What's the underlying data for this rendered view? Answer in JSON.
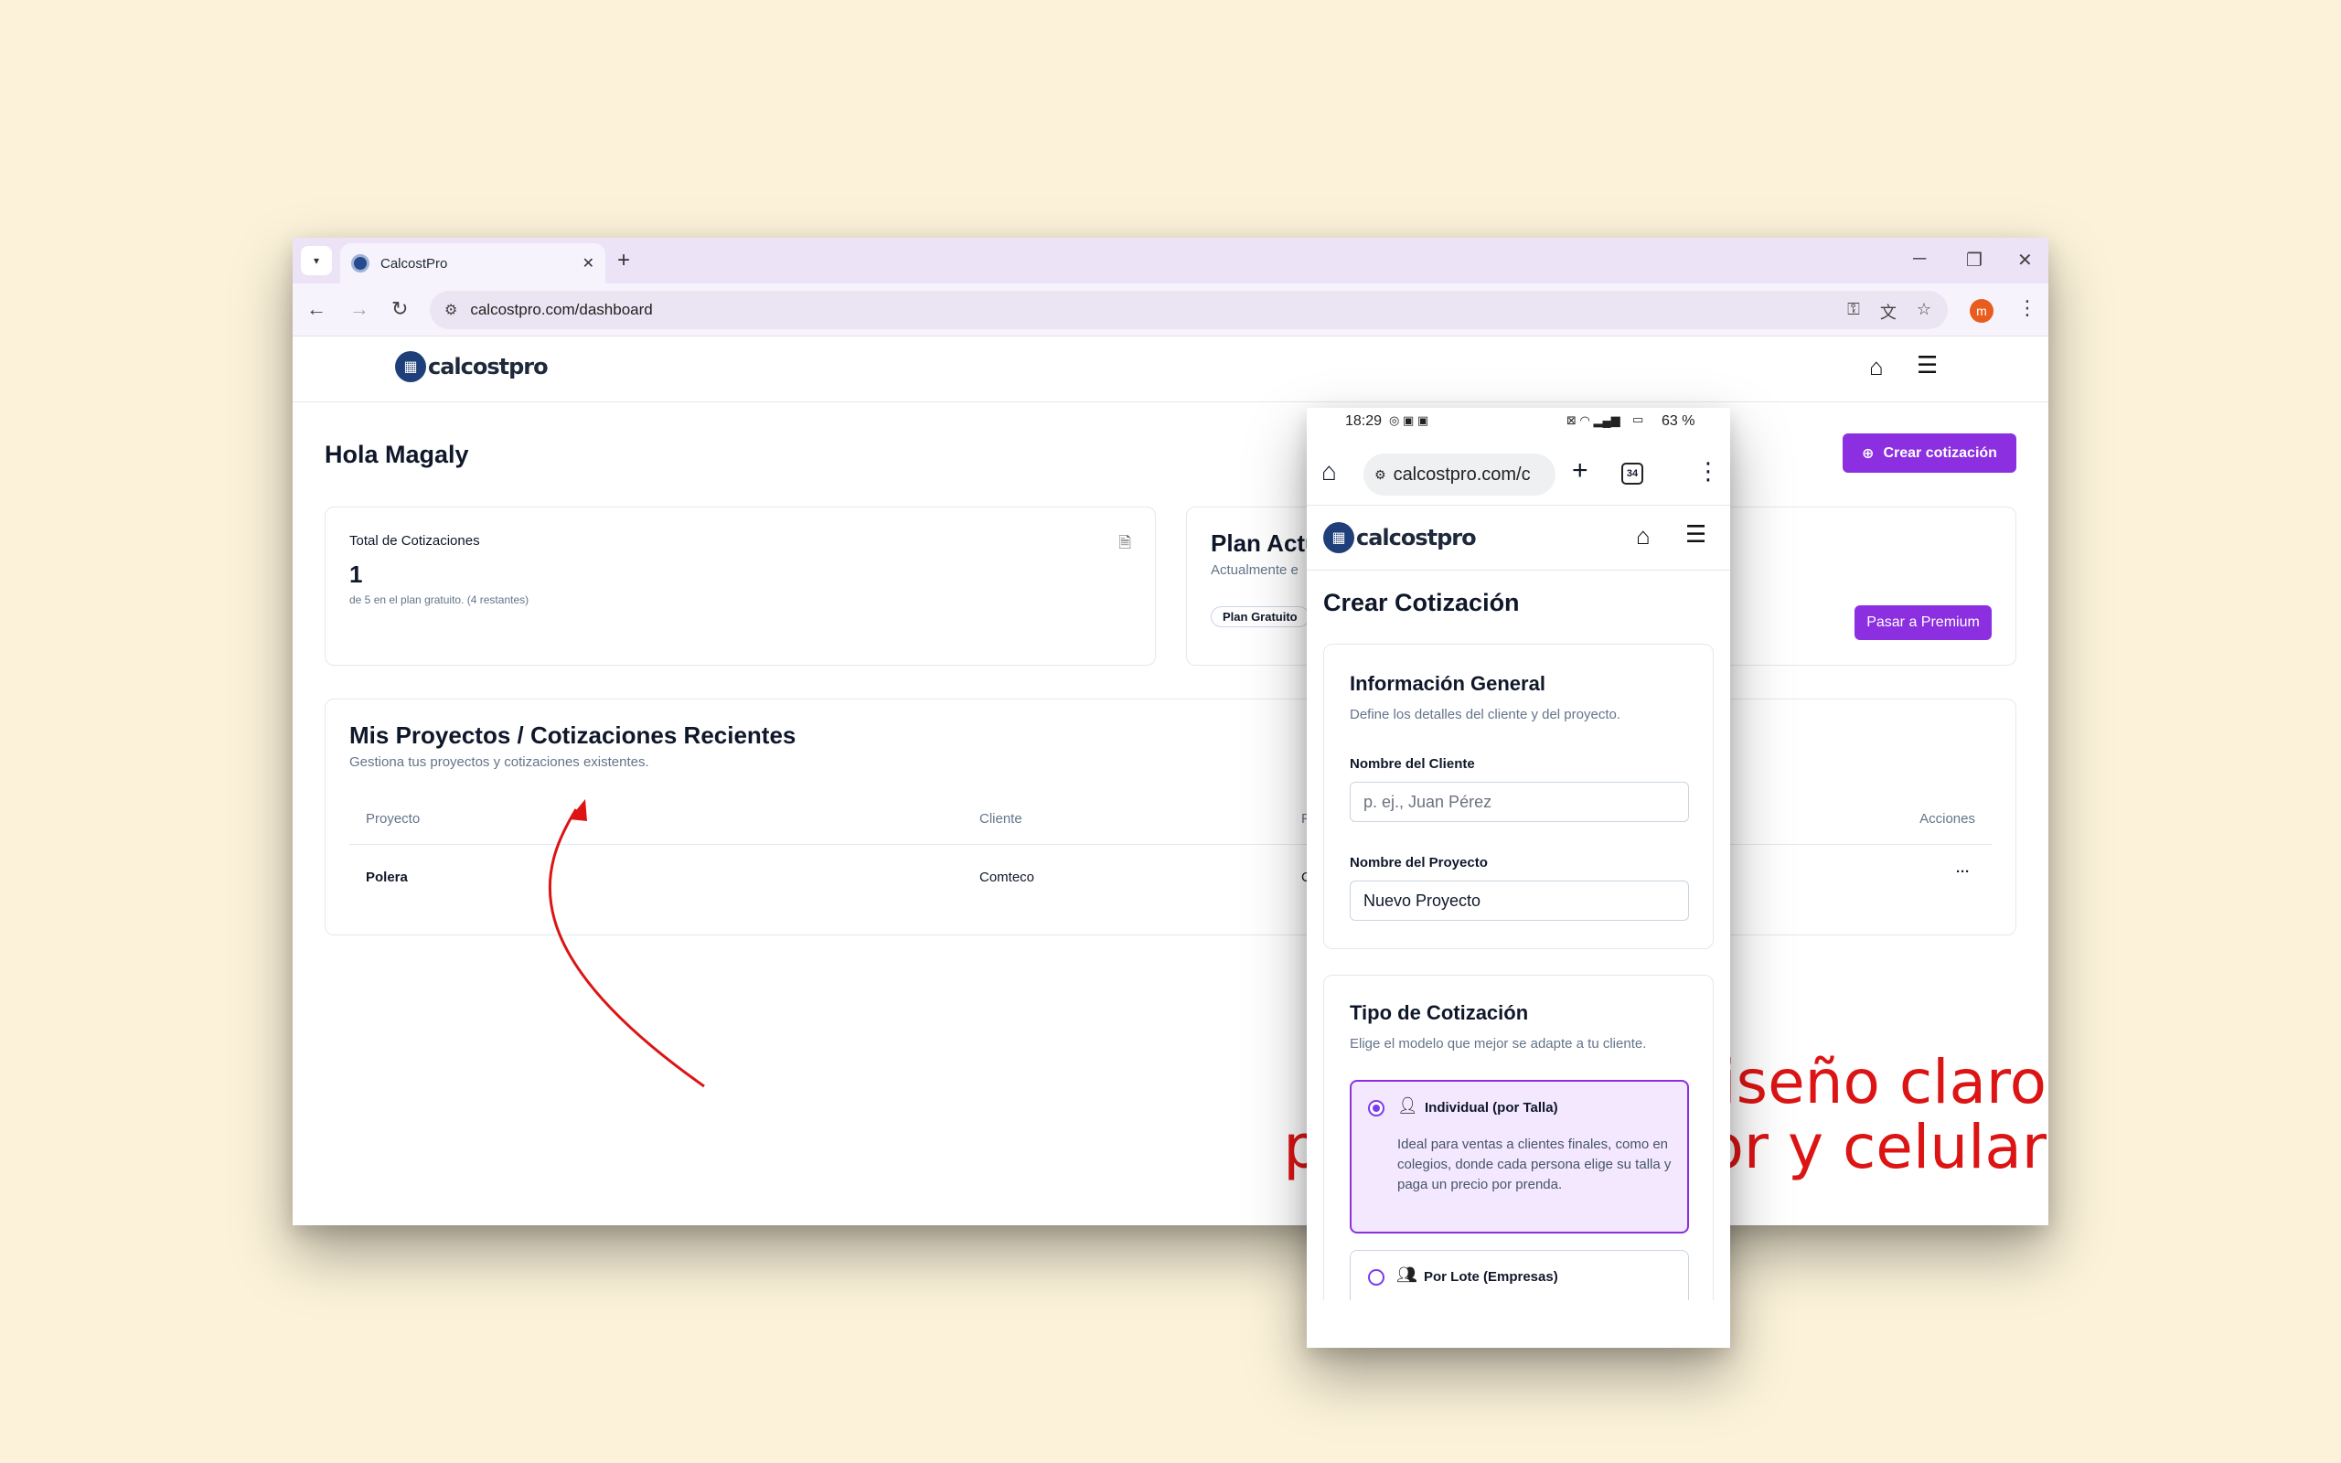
{
  "desktop": {
    "tab_title": "CalcostPro",
    "url": "calcostpro.com/dashboard",
    "profile_initial": "m",
    "logo_text": "calcostpro",
    "greeting": "Hola Magaly",
    "create_button": "Crear cotización",
    "total_card": {
      "title": "Total de Cotizaciones",
      "value": "1",
      "subtitle": "de 5 en el plan gratuito. (4 restantes)"
    },
    "plan_card": {
      "title": "Plan Actu",
      "subtitle": "Actualmente e",
      "badge": "Plan Gratuito",
      "premium_button": "Pasar a Premium"
    },
    "projects": {
      "title": "Mis Proyectos / Cotizaciones Recientes",
      "subtitle": "Gestiona tus proyectos y cotizaciones existentes.",
      "columns": [
        "Proyecto",
        "Cliente",
        "F",
        "Acciones"
      ],
      "rows": [
        {
          "proyecto": "Polera",
          "cliente": "Comteco",
          "f": "C",
          "acciones": "···"
        }
      ]
    }
  },
  "annotation": {
    "line1": "un diseño claro",
    "line2": "por computador y celular",
    "color": "#dc1414"
  },
  "phone": {
    "time": "18:29",
    "battery": "63 %",
    "url": "calcostpro.com/c",
    "tab_count": "34",
    "logo_text": "calcostpro",
    "page_title": "Crear Cotización",
    "general": {
      "title": "Información General",
      "subtitle": "Define los detalles del cliente y del proyecto.",
      "client_label": "Nombre del Cliente",
      "client_placeholder": "p. ej., Juan Pérez",
      "project_label": "Nombre del Proyecto",
      "project_value": "Nuevo Proyecto"
    },
    "tipo": {
      "title": "Tipo de Cotización",
      "subtitle": "Elige el modelo que mejor se adapte a tu cliente.",
      "options": [
        {
          "label": "Individual (por Talla)",
          "description": "Ideal para ventas a clientes finales, como en colegios, donde cada persona elige su talla y paga un precio por prenda.",
          "selected": true
        },
        {
          "label": "Por Lote (Empresas)",
          "description": "",
          "selected": false
        }
      ]
    }
  },
  "colors": {
    "accent": "#8b2fe0",
    "background": "#fbf2d9",
    "brand": "#1f3f7a"
  }
}
